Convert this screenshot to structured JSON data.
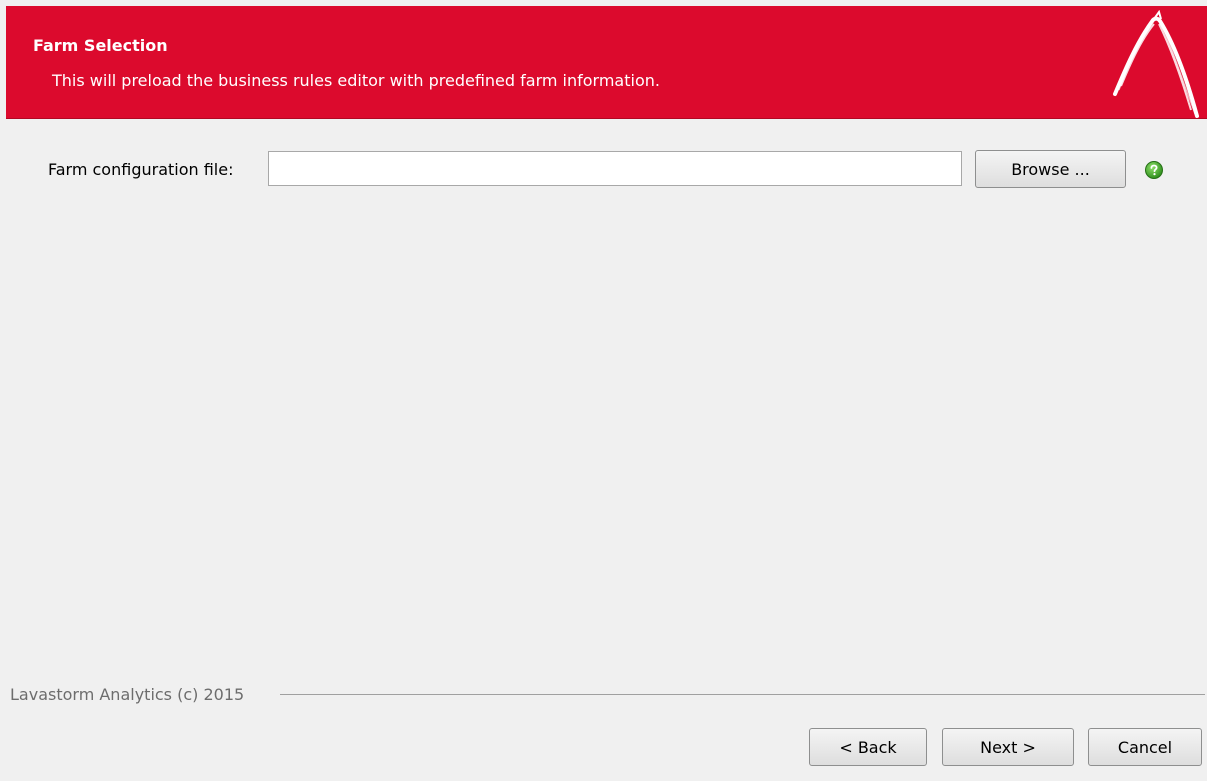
{
  "header": {
    "title": "Farm Selection",
    "subtitle": "This will preload the business rules editor with predefined farm information.",
    "background_color": "#dc0a2d",
    "logo_icon": "lavastorm-arc-logo"
  },
  "form": {
    "farm_config_label": "Farm configuration file:",
    "farm_config_value": "",
    "browse_label": "Browse ...",
    "help_icon": "green-question-mark-icon"
  },
  "footer": {
    "copyright": "Lavastorm Analytics (c) 2015"
  },
  "buttons": {
    "back_label": "< Back",
    "next_label": "Next >",
    "cancel_label": "Cancel"
  }
}
